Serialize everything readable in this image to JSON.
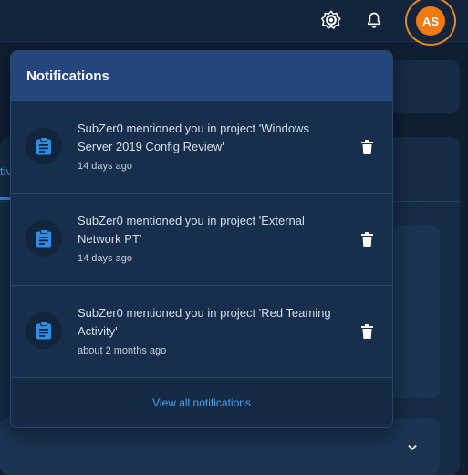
{
  "header": {
    "avatar_initials": "AS",
    "icons": [
      "theme-toggle-icon",
      "bell-icon"
    ]
  },
  "background": {
    "tab_partial_label": "tiv"
  },
  "notifications": {
    "title": "Notifications",
    "items": [
      {
        "message": "SubZer0 mentioned you in project 'Windows Server 2019 Config Review'",
        "time": "14 days ago"
      },
      {
        "message": "SubZer0 mentioned you in project 'External Network PT'",
        "time": "14 days ago"
      },
      {
        "message": "SubZer0 mentioned you in project 'Red Teaming Activity'",
        "time": "about 2 months ago"
      }
    ],
    "view_all_label": "View all notifications"
  },
  "colors": {
    "accent": "#2f8de4",
    "avatar": "#f07a12",
    "header": "#24467c"
  }
}
